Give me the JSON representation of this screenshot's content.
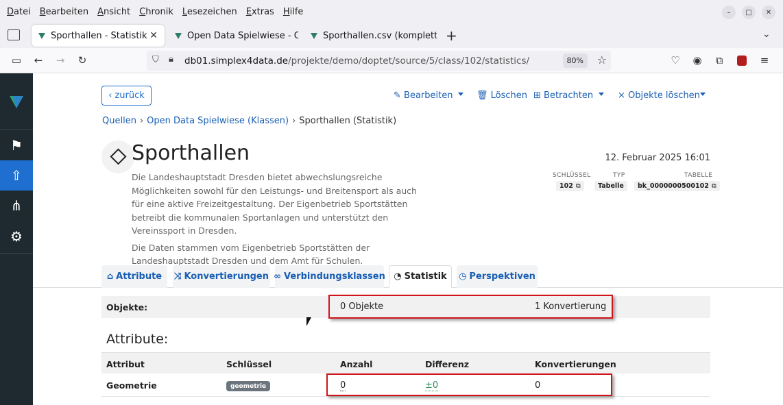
{
  "browser": {
    "menu": [
      "Datei",
      "Bearbeiten",
      "Ansicht",
      "Chronik",
      "Lesezeichen",
      "Extras",
      "Hilfe"
    ],
    "menu_access": [
      "D",
      "B",
      "A",
      "C",
      "L",
      "E",
      "H"
    ],
    "tabs": [
      {
        "label": "Sporthallen - Statistik"
      },
      {
        "label": "Open Data Spielwiese - Q"
      },
      {
        "label": "Sporthallen.csv (komplett"
      }
    ],
    "url_host": "db01.simplex4data.de",
    "url_path": "/projekte/demo/doptet/source/5/class/102/statistics/",
    "zoom": "80%"
  },
  "toolbar": {
    "back_label": "zurück",
    "edit_label": "Bearbeiten",
    "delete_label": "Löschen",
    "view_label": "Betrachten",
    "delete_objects_label": "Objekte löschen"
  },
  "breadcrumb": {
    "root": "Quellen",
    "parent": "Open Data Spielwiese (Klassen)",
    "current": "Sporthallen (Statistik)"
  },
  "header": {
    "title": "Sporthallen",
    "description_1": "Die Landeshauptstadt Dresden bietet abwechslungsreiche Möglichkeiten sowohl für den Leistungs- und Breitensport als auch für eine aktive Freizeitgestaltung. Der Eigenbetrieb Sportstätten betreibt die kommunalen Sportanlagen und unterstützt den Vereinssport in Dresden.",
    "description_2": "Die Daten stammen vom Eigenbetrieb Sportstätten der Landeshauptstadt Dresden und dem Amt für Schulen.",
    "date": "12. Februar 2025 16:01",
    "key_label": "SCHLÜSSEL",
    "key_value": "102",
    "type_label": "TYP",
    "type_value": "Tabelle",
    "table_label": "TABELLE",
    "table_value": "bk_0000000500102"
  },
  "content_tabs": [
    {
      "label": "Attribute"
    },
    {
      "label": "Konvertierungen"
    },
    {
      "label": "Verbindungsklassen"
    },
    {
      "label": "Statistik"
    },
    {
      "label": "Perspektiven"
    }
  ],
  "objects_row": {
    "label": "Objekte:",
    "count": "0 Objekte",
    "conversions": "1 Konvertierung"
  },
  "attributes": {
    "heading": "Attribute:",
    "columns": [
      "Attribut",
      "Schlüssel",
      "Anzahl",
      "Differenz",
      "Konvertierungen"
    ],
    "rows": [
      {
        "name": "Geometrie",
        "key": "geometrie",
        "count": "0",
        "diff": "±0",
        "conversions": "0"
      }
    ]
  }
}
